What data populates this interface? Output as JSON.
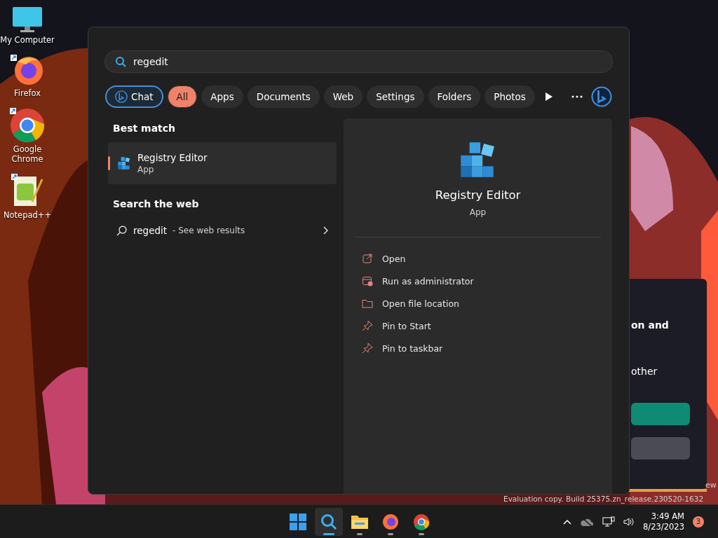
{
  "desktop_icons": [
    {
      "label": "My Computer",
      "kind": "computer"
    },
    {
      "label": "Firefox",
      "kind": "firefox"
    },
    {
      "label": "Google Chrome",
      "kind": "chrome"
    },
    {
      "label": "Notepad++",
      "kind": "notepad"
    }
  ],
  "background_window": {
    "lines": [
      "on and",
      "other"
    ]
  },
  "watermark": [
    "ew",
    "Evaluation copy. Build 25375.zn_release.230520-1632"
  ],
  "search": {
    "value": "regedit"
  },
  "filters": [
    {
      "label": "Chat",
      "kind": "chat",
      "selected": false
    },
    {
      "label": "All",
      "kind": "text",
      "selected": true
    },
    {
      "label": "Apps",
      "kind": "text",
      "selected": false
    },
    {
      "label": "Documents",
      "kind": "text",
      "selected": false
    },
    {
      "label": "Web",
      "kind": "text",
      "selected": false
    },
    {
      "label": "Settings",
      "kind": "text",
      "selected": false
    },
    {
      "label": "Folders",
      "kind": "text",
      "selected": false
    },
    {
      "label": "Photos",
      "kind": "text",
      "selected": false
    }
  ],
  "best_match": {
    "heading": "Best match",
    "title": "Registry Editor",
    "subtitle": "App",
    "selected": true
  },
  "web_search": {
    "heading": "Search the web",
    "query": "regedit",
    "hint": "- See web results"
  },
  "detail": {
    "title": "Registry Editor",
    "subtitle": "App",
    "actions": [
      {
        "label": "Open",
        "kind": "open"
      },
      {
        "label": "Run as administrator",
        "kind": "admin"
      },
      {
        "label": "Open file location",
        "kind": "folder"
      },
      {
        "label": "Pin to Start",
        "kind": "pin"
      },
      {
        "label": "Pin to taskbar",
        "kind": "pin"
      }
    ]
  },
  "taskbar": {
    "apps": [
      {
        "kind": "start",
        "active": false,
        "running": false
      },
      {
        "kind": "search",
        "active": true,
        "running": false
      },
      {
        "kind": "explorer",
        "active": false,
        "running": true
      },
      {
        "kind": "firefox",
        "active": false,
        "running": true
      },
      {
        "kind": "chrome",
        "active": false,
        "running": true
      }
    ],
    "time": "3:49 AM",
    "date": "8/23/2023",
    "badge": "3"
  }
}
